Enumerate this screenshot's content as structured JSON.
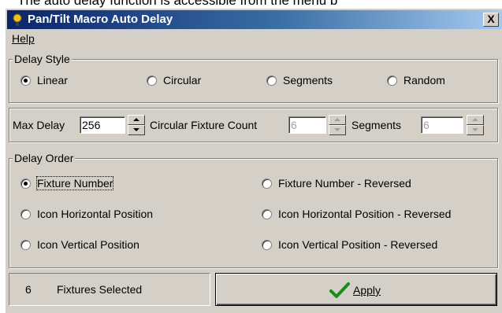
{
  "page_caption": "The auto delay function is accessible from the menu b",
  "window": {
    "title": "Pan/Tilt Macro Auto Delay",
    "close_label": "X"
  },
  "menu": {
    "help_label": "Help"
  },
  "delay_style": {
    "legend": "Delay Style",
    "options": [
      "Linear",
      "Circular",
      "Segments",
      "Random"
    ],
    "selected": "Linear"
  },
  "settings": {
    "max_delay_label": "Max Delay",
    "max_delay_value": "256",
    "circular_fixture_count_label": "Circular Fixture Count",
    "circular_fixture_count_value": "6",
    "segments_label": "Segments",
    "segments_value": "6"
  },
  "delay_order": {
    "legend": "Delay Order",
    "options": [
      "Fixture Number",
      "Fixture Number - Reversed",
      "Icon Horizontal Position",
      "Icon Horizontal Position - Reversed",
      "Icon Vertical Position",
      "Icon Vertical Position - Reversed"
    ],
    "selected": "Fixture Number"
  },
  "status": {
    "count": "6",
    "label": "Fixtures Selected"
  },
  "apply": {
    "label": "Apply",
    "icon": "checkmark-icon",
    "icon_color": "#1a8a1a"
  },
  "colors": {
    "titlebar_start": "#0a246a",
    "titlebar_end": "#a6caf0",
    "face": "#d4d0c8"
  }
}
